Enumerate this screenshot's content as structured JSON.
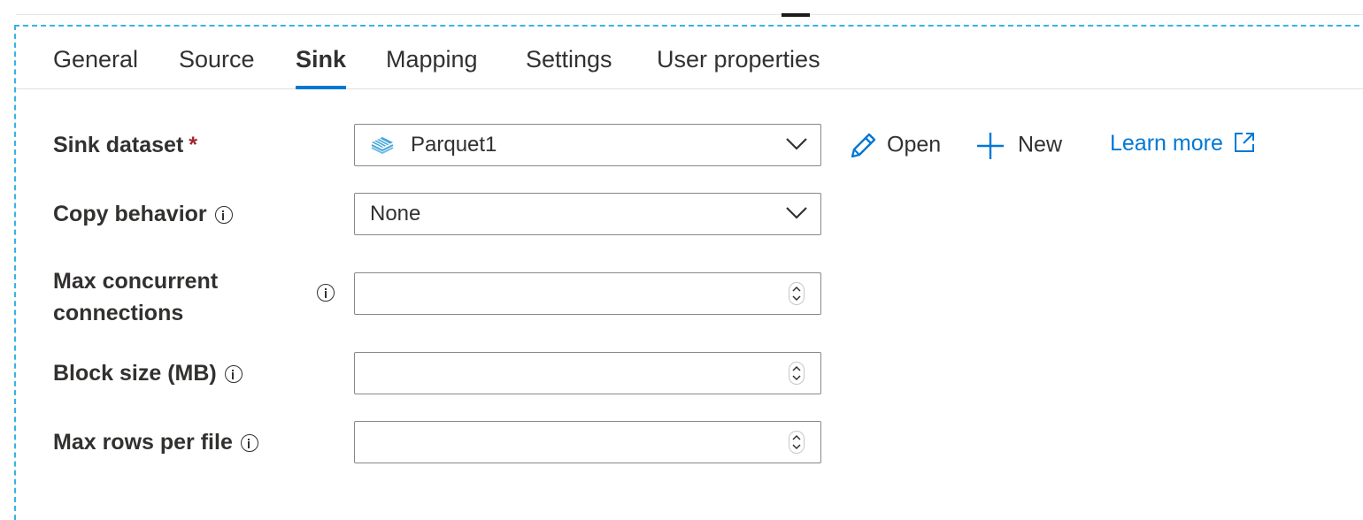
{
  "tabs": [
    {
      "label": "General"
    },
    {
      "label": "Source"
    },
    {
      "label": "Sink",
      "active": true
    },
    {
      "label": "Mapping"
    },
    {
      "label": "Settings"
    },
    {
      "label": "User properties"
    }
  ],
  "form": {
    "sink_dataset": {
      "label": "Sink dataset",
      "required_mark": "*",
      "value": "Parquet1",
      "icon": "parquet-dataset-icon"
    },
    "copy_behavior": {
      "label": "Copy behavior",
      "value": "None"
    },
    "max_concurrent": {
      "label_line1": "Max concurrent",
      "label_line2": "connections",
      "value": ""
    },
    "block_size": {
      "label": "Block size (MB)",
      "value": ""
    },
    "max_rows": {
      "label": "Max rows per file",
      "value": ""
    }
  },
  "actions": {
    "open": "Open",
    "new": "New",
    "learn_more": "Learn more"
  },
  "colors": {
    "accent": "#0078d4",
    "dashed_border": "#39b2e3",
    "required": "#a4262c"
  }
}
